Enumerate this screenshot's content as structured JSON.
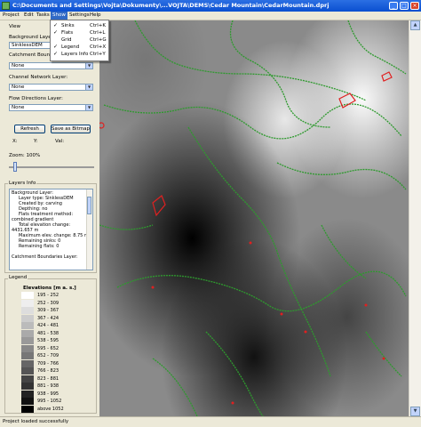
{
  "window": {
    "title": "C:\\Documents and Settings\\Vojta\\Dokumenty\\...VOJTA\\DEMS\\Cedar Mountain\\CedarMountain.dprj",
    "controls": [
      "minimize-icon",
      "maximize-icon",
      "close-icon"
    ]
  },
  "menu": {
    "items": [
      "Project",
      "Edit",
      "Tasks",
      "Show",
      "Settings",
      "Help"
    ],
    "active": "Show"
  },
  "show_menu": {
    "items": [
      {
        "label": "Sinks",
        "shortcut": "Ctrl+K",
        "checked": true
      },
      {
        "label": "Flats",
        "shortcut": "Ctrl+L",
        "checked": true
      },
      {
        "label": "Grid",
        "shortcut": "Ctrl+G",
        "checked": false
      },
      {
        "label": "Legend",
        "shortcut": "Ctrl+X",
        "checked": true
      },
      {
        "label": "Layers Info",
        "shortcut": "Ctrl+Y",
        "checked": true
      }
    ]
  },
  "view_panel": {
    "heading": "View",
    "background_label": "Background Layer:",
    "background_value": "SinklessDEM",
    "catchment_label": "Catchment Boundaries Layer:",
    "catchment_value": "None",
    "channel_label": "Channel Network Layer:",
    "channel_value": "None",
    "flowdir_label": "Flow Directions Layer:",
    "flowdir_value": "None",
    "refresh_button": "Refresh",
    "save_button": "Save as Bitmap",
    "x_label": "X:",
    "y_label": "Y:",
    "val_label": "Val:",
    "zoom_label": "Zoom: 100%",
    "zoom_value": 100
  },
  "layers_info": {
    "heading": "Layers Info",
    "lines": [
      "Background Layer:",
      "Layer type: SinklessDEM",
      "Created by: carving",
      "Depthing: no",
      "Flats treatment method:",
      "combined gradient",
      "Total elevation change:",
      "4431.657 m",
      "Maximum elev. change: 8.75 m",
      "Remaining sinks: 0",
      "Remaining flats: 0",
      "",
      "Catchment Boundaries Layer:"
    ]
  },
  "legend": {
    "heading": "Legend",
    "title": "Elevations [m a. s.]",
    "entries": [
      {
        "range": "195 - 252",
        "color": "#ffffff"
      },
      {
        "range": "252 - 309",
        "color": "#eeeeee"
      },
      {
        "range": "309 - 367",
        "color": "#dddddd"
      },
      {
        "range": "367 - 424",
        "color": "#cccccc"
      },
      {
        "range": "424 - 481",
        "color": "#bbbbbb"
      },
      {
        "range": "481 - 538",
        "color": "#aaaaaa"
      },
      {
        "range": "538 - 595",
        "color": "#999999"
      },
      {
        "range": "595 - 652",
        "color": "#888888"
      },
      {
        "range": "652 - 709",
        "color": "#777777"
      },
      {
        "range": "709 - 766",
        "color": "#666666"
      },
      {
        "range": "766 - 823",
        "color": "#555555"
      },
      {
        "range": "823 - 881",
        "color": "#444444"
      },
      {
        "range": "881 - 938",
        "color": "#333333"
      },
      {
        "range": "938 - 995",
        "color": "#222222"
      },
      {
        "range": "995 - 1052",
        "color": "#111111"
      },
      {
        "range": "above 1052",
        "color": "#000000"
      }
    ]
  },
  "map": {
    "flats_color": "#2e9a2e",
    "sinks_color": "#e02020"
  },
  "status": {
    "text": "Project loaded successfully"
  }
}
